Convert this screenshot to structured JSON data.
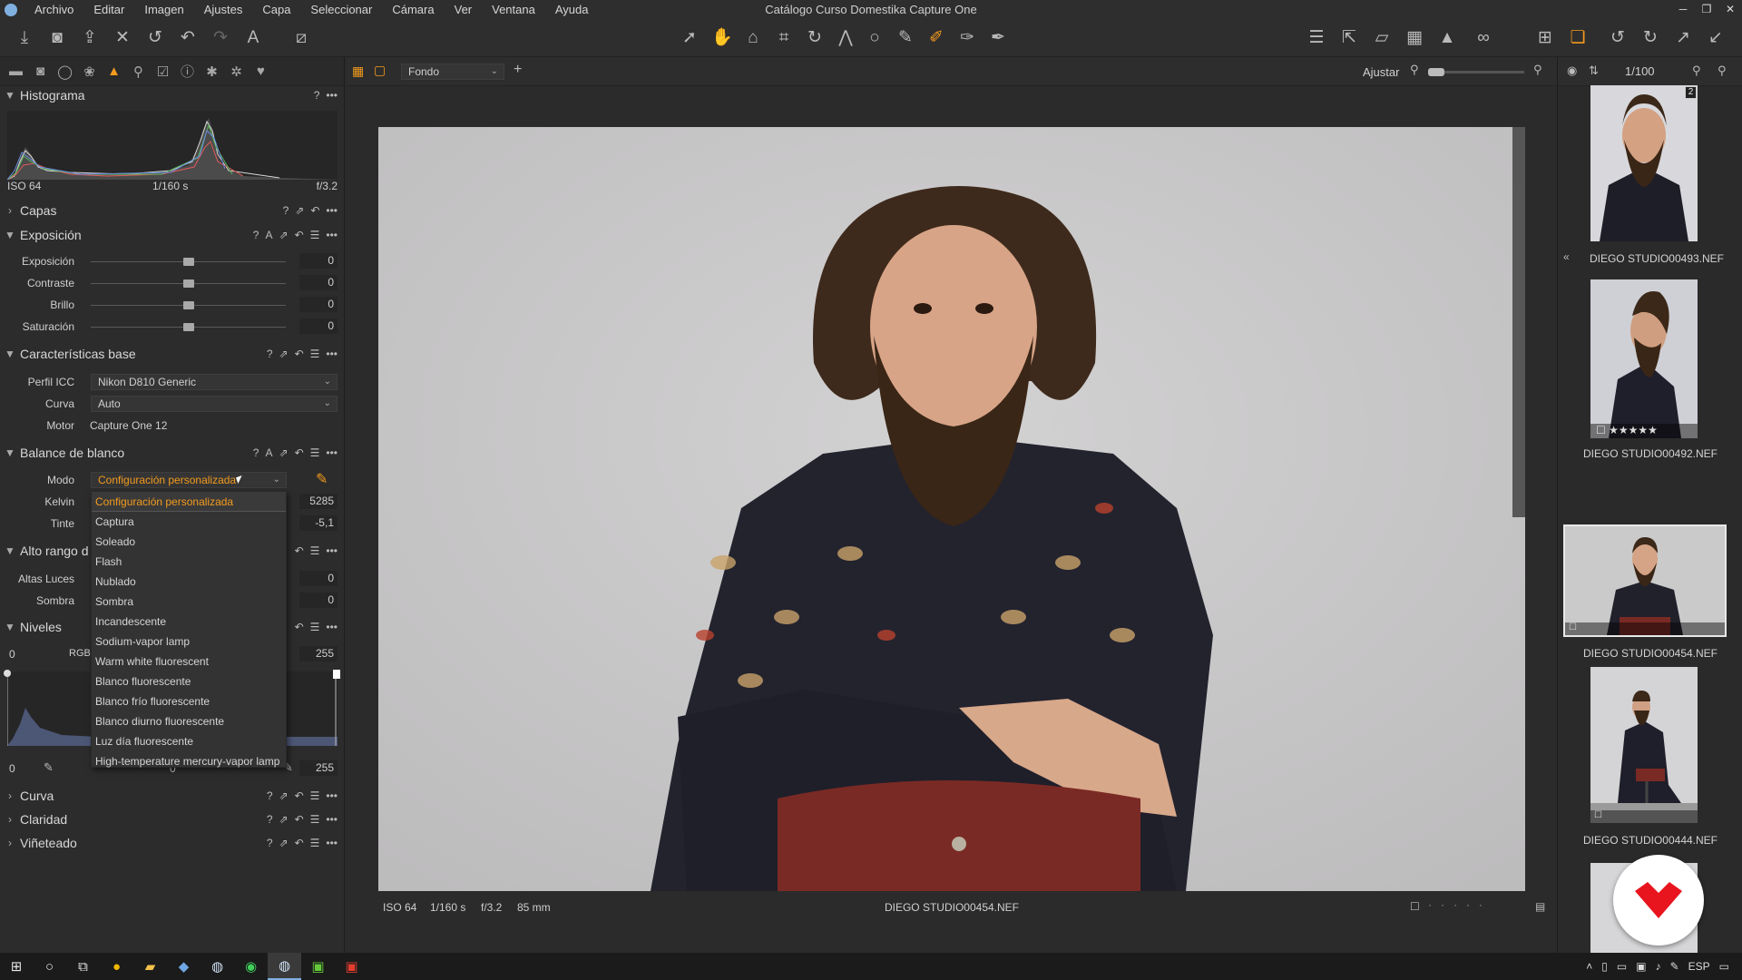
{
  "window": {
    "title": "Catálogo Curso Domestika Capture One",
    "controls": [
      "─",
      "❐",
      "✕"
    ]
  },
  "menu": [
    "Archivo",
    "Editar",
    "Imagen",
    "Ajustes",
    "Capa",
    "Seleccionar",
    "Cámara",
    "Ver",
    "Ventana",
    "Ayuda"
  ],
  "toolbar": {
    "left_icons": [
      "import-icon",
      "camera-icon",
      "export-icon",
      "delete-icon",
      "undo-history-icon",
      "undo-icon",
      "redo-icon",
      "text-icon",
      "edit-icon"
    ],
    "center_icons": [
      "select-cursor-icon",
      "pan-hand-icon",
      "loupe-icon",
      "crop-icon",
      "rotate-icon",
      "keystone-icon",
      "spot-icon",
      "picker-icon",
      "brush-icon",
      "eraser-icon",
      "gradient-icon"
    ],
    "right_icons": [
      "library-icon",
      "share-icon",
      "proof-icon",
      "grid-icon",
      "warning-icon",
      "glasses-icon",
      "compare-icon",
      "layers-icon",
      "rotate-left-icon",
      "rotate-right-icon",
      "expand-icon",
      "collapse-icon"
    ]
  },
  "tool_tabs": [
    "library-tab-icon",
    "capture-tab-icon",
    "lens-tab-icon",
    "color-tab-icon",
    "exposure-tab-icon",
    "details-tab-icon",
    "adjustments-tab-icon",
    "metadata-tab-icon",
    "output-tab-icon",
    "batch-tab-icon",
    "favorites-tab-icon"
  ],
  "histogram": {
    "title": "Histograma",
    "iso": "ISO 64",
    "shutter": "1/160 s",
    "aperture": "f/3.2"
  },
  "sections": {
    "capas": "Capas",
    "exposicion": "Exposición",
    "caracteristicas": "Características base",
    "balance": "Balance de blanco",
    "alto_rango": "Alto rango d",
    "niveles": "Niveles",
    "curva": "Curva",
    "claridad": "Claridad",
    "vineteado": "Viñeteado"
  },
  "exposure": {
    "sliders": [
      {
        "label": "Exposición",
        "value": "0",
        "position": 0.5
      },
      {
        "label": "Contraste",
        "value": "0",
        "position": 0.5
      },
      {
        "label": "Brillo",
        "value": "0",
        "position": 0.5
      },
      {
        "label": "Saturación",
        "value": "0",
        "position": 0.5
      }
    ]
  },
  "base": {
    "icc_label": "Perfil ICC",
    "icc_value": "Nikon D810 Generic",
    "curve_label": "Curva",
    "curve_value": "Auto",
    "engine_label": "Motor",
    "engine_value": "Capture One 12"
  },
  "white_balance": {
    "mode_label": "Modo",
    "mode_value": "Configuración personalizada",
    "kelvin_label": "Kelvin",
    "kelvin_value": "5285",
    "tint_label": "Tinte",
    "tint_value": "-5,1",
    "options": [
      "Configuración personalizada",
      "Captura",
      "Soleado",
      "Flash",
      "Nublado",
      "Sombra",
      "Incandescente",
      "Sodium-vapor lamp",
      "Warm white fluorescent",
      "Blanco fluorescente",
      "Blanco frío fluorescente",
      "Blanco diurno fluorescente",
      "Luz día fluorescente",
      "High-temperature mercury-vapor lamp"
    ]
  },
  "hdr": {
    "highlights_label": "Altas Luces",
    "highlights_value": "0",
    "shadows_label": "Sombra",
    "shadows_value": "0"
  },
  "levels": {
    "low_in": "0",
    "channel": "RGB",
    "high_in": "255",
    "low_out": "0",
    "mid_out": "0",
    "high_out": "255"
  },
  "viewer": {
    "layer_select": "Fondo",
    "fit_label": "Ajustar",
    "counter": "1/100",
    "info_iso": "ISO 64",
    "info_shutter": "1/160 s",
    "info_aperture": "f/3.2",
    "info_focal": "85 mm",
    "filename": "DIEGO STUDIO00454.NEF"
  },
  "browser": {
    "thumbs": [
      {
        "name": "DIEGO STUDIO00493.NEF",
        "badge": "2"
      },
      {
        "name": "DIEGO STUDIO00492.NEF",
        "badge": ""
      },
      {
        "name": "DIEGO STUDIO00454.NEF",
        "badge": ""
      },
      {
        "name": "DIEGO STUDIO00444.NEF",
        "badge": ""
      }
    ]
  },
  "taskbar": {
    "lang": "ESP"
  },
  "colors": {
    "accent": "#f39b1e",
    "panel": "#2c2c2c",
    "brand_red": "#e8141e"
  }
}
